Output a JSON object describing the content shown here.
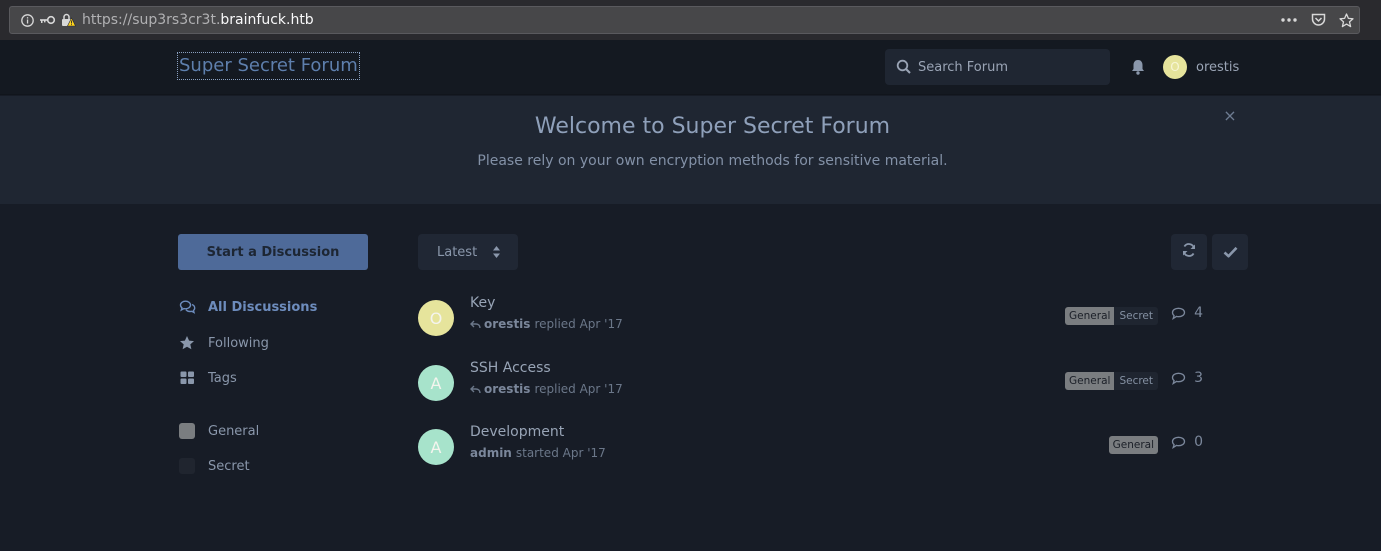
{
  "browser": {
    "url_scheme": "https://",
    "url_subdomain": "sup3rs3cr3t.",
    "url_domain": "brainfuck.htb"
  },
  "header": {
    "forum_title": "Super Secret Forum",
    "search_placeholder": "Search Forum",
    "username": "orestis",
    "avatar_letter": "O"
  },
  "hero": {
    "title": "Welcome to Super Secret Forum",
    "subtitle": "Please rely on your own encryption methods for sensitive material.",
    "close_icon": "×"
  },
  "sidebar": {
    "start_button": "Start a Discussion",
    "nav": [
      {
        "label": "All Discussions",
        "icon": "comments-icon"
      },
      {
        "label": "Following",
        "icon": "star-icon"
      },
      {
        "label": "Tags",
        "icon": "grid-icon"
      }
    ],
    "tags": [
      {
        "label": "General",
        "color": "#7a7d80"
      },
      {
        "label": "Secret",
        "color": "#20252f"
      }
    ]
  },
  "toolbar": {
    "sort_label": "Latest"
  },
  "discussions": [
    {
      "avatar": "O",
      "avatar_color": "#e6e49c",
      "title": "Key",
      "user": "orestis",
      "action": "replied Apr '17",
      "replied": true,
      "tags": [
        "General",
        "Secret"
      ],
      "count": "4"
    },
    {
      "avatar": "A",
      "avatar_color": "#a7e3cb",
      "title": "SSH Access",
      "user": "orestis",
      "action": "replied Apr '17",
      "replied": true,
      "tags": [
        "General",
        "Secret"
      ],
      "count": "3"
    },
    {
      "avatar": "A",
      "avatar_color": "#a7e3cb",
      "title": "Development",
      "user": "admin",
      "action": "started Apr '17",
      "replied": false,
      "tags": [
        "General"
      ],
      "count": "0"
    }
  ]
}
